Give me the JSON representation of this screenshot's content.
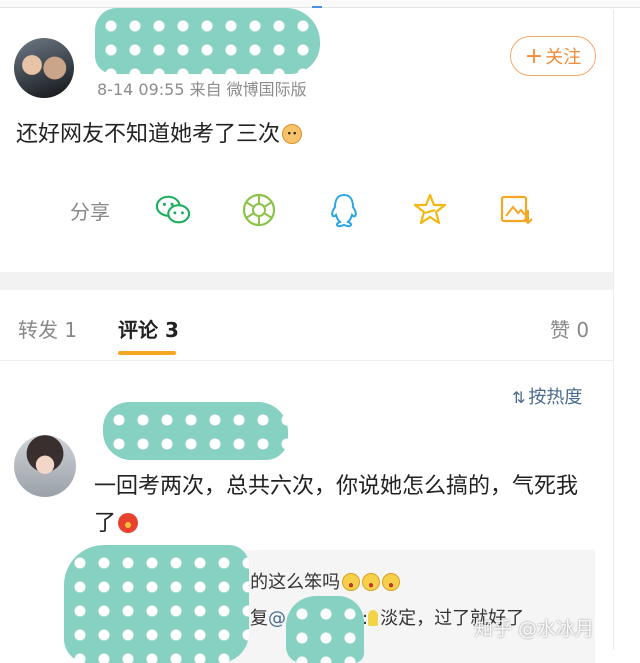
{
  "post": {
    "meta": "8-14 09:55  来自 微博国际版",
    "follow_plus": "+",
    "follow_label": "关注",
    "text": "还好网友不知道她考了三次"
  },
  "share": {
    "label": "分享",
    "icons": [
      "wechat-icon",
      "moments-icon",
      "qq-icon",
      "qzone-star-icon",
      "save-image-icon"
    ]
  },
  "tabs": {
    "repost": "转发 1",
    "comments": "评论 3",
    "likes": "赞 0"
  },
  "sort": {
    "label": "按热度"
  },
  "comment": {
    "text": "一回考两次，总共六次，你说她怎么搞的，气死我了",
    "replies": {
      "r1_text": ":不会吧真的这么笨吗",
      "r2_prefix": "回复",
      "r2_at": "@",
      "r2_suffix": ":",
      "r2_text": "淡定，过了就好了"
    }
  },
  "watermark": "知乎 @水冰月",
  "colors": {
    "accent_orange": "#f28c38",
    "tab_underline": "#f5a623",
    "link_blue": "#4a6b8c",
    "mask_teal": "#86d1c2"
  }
}
